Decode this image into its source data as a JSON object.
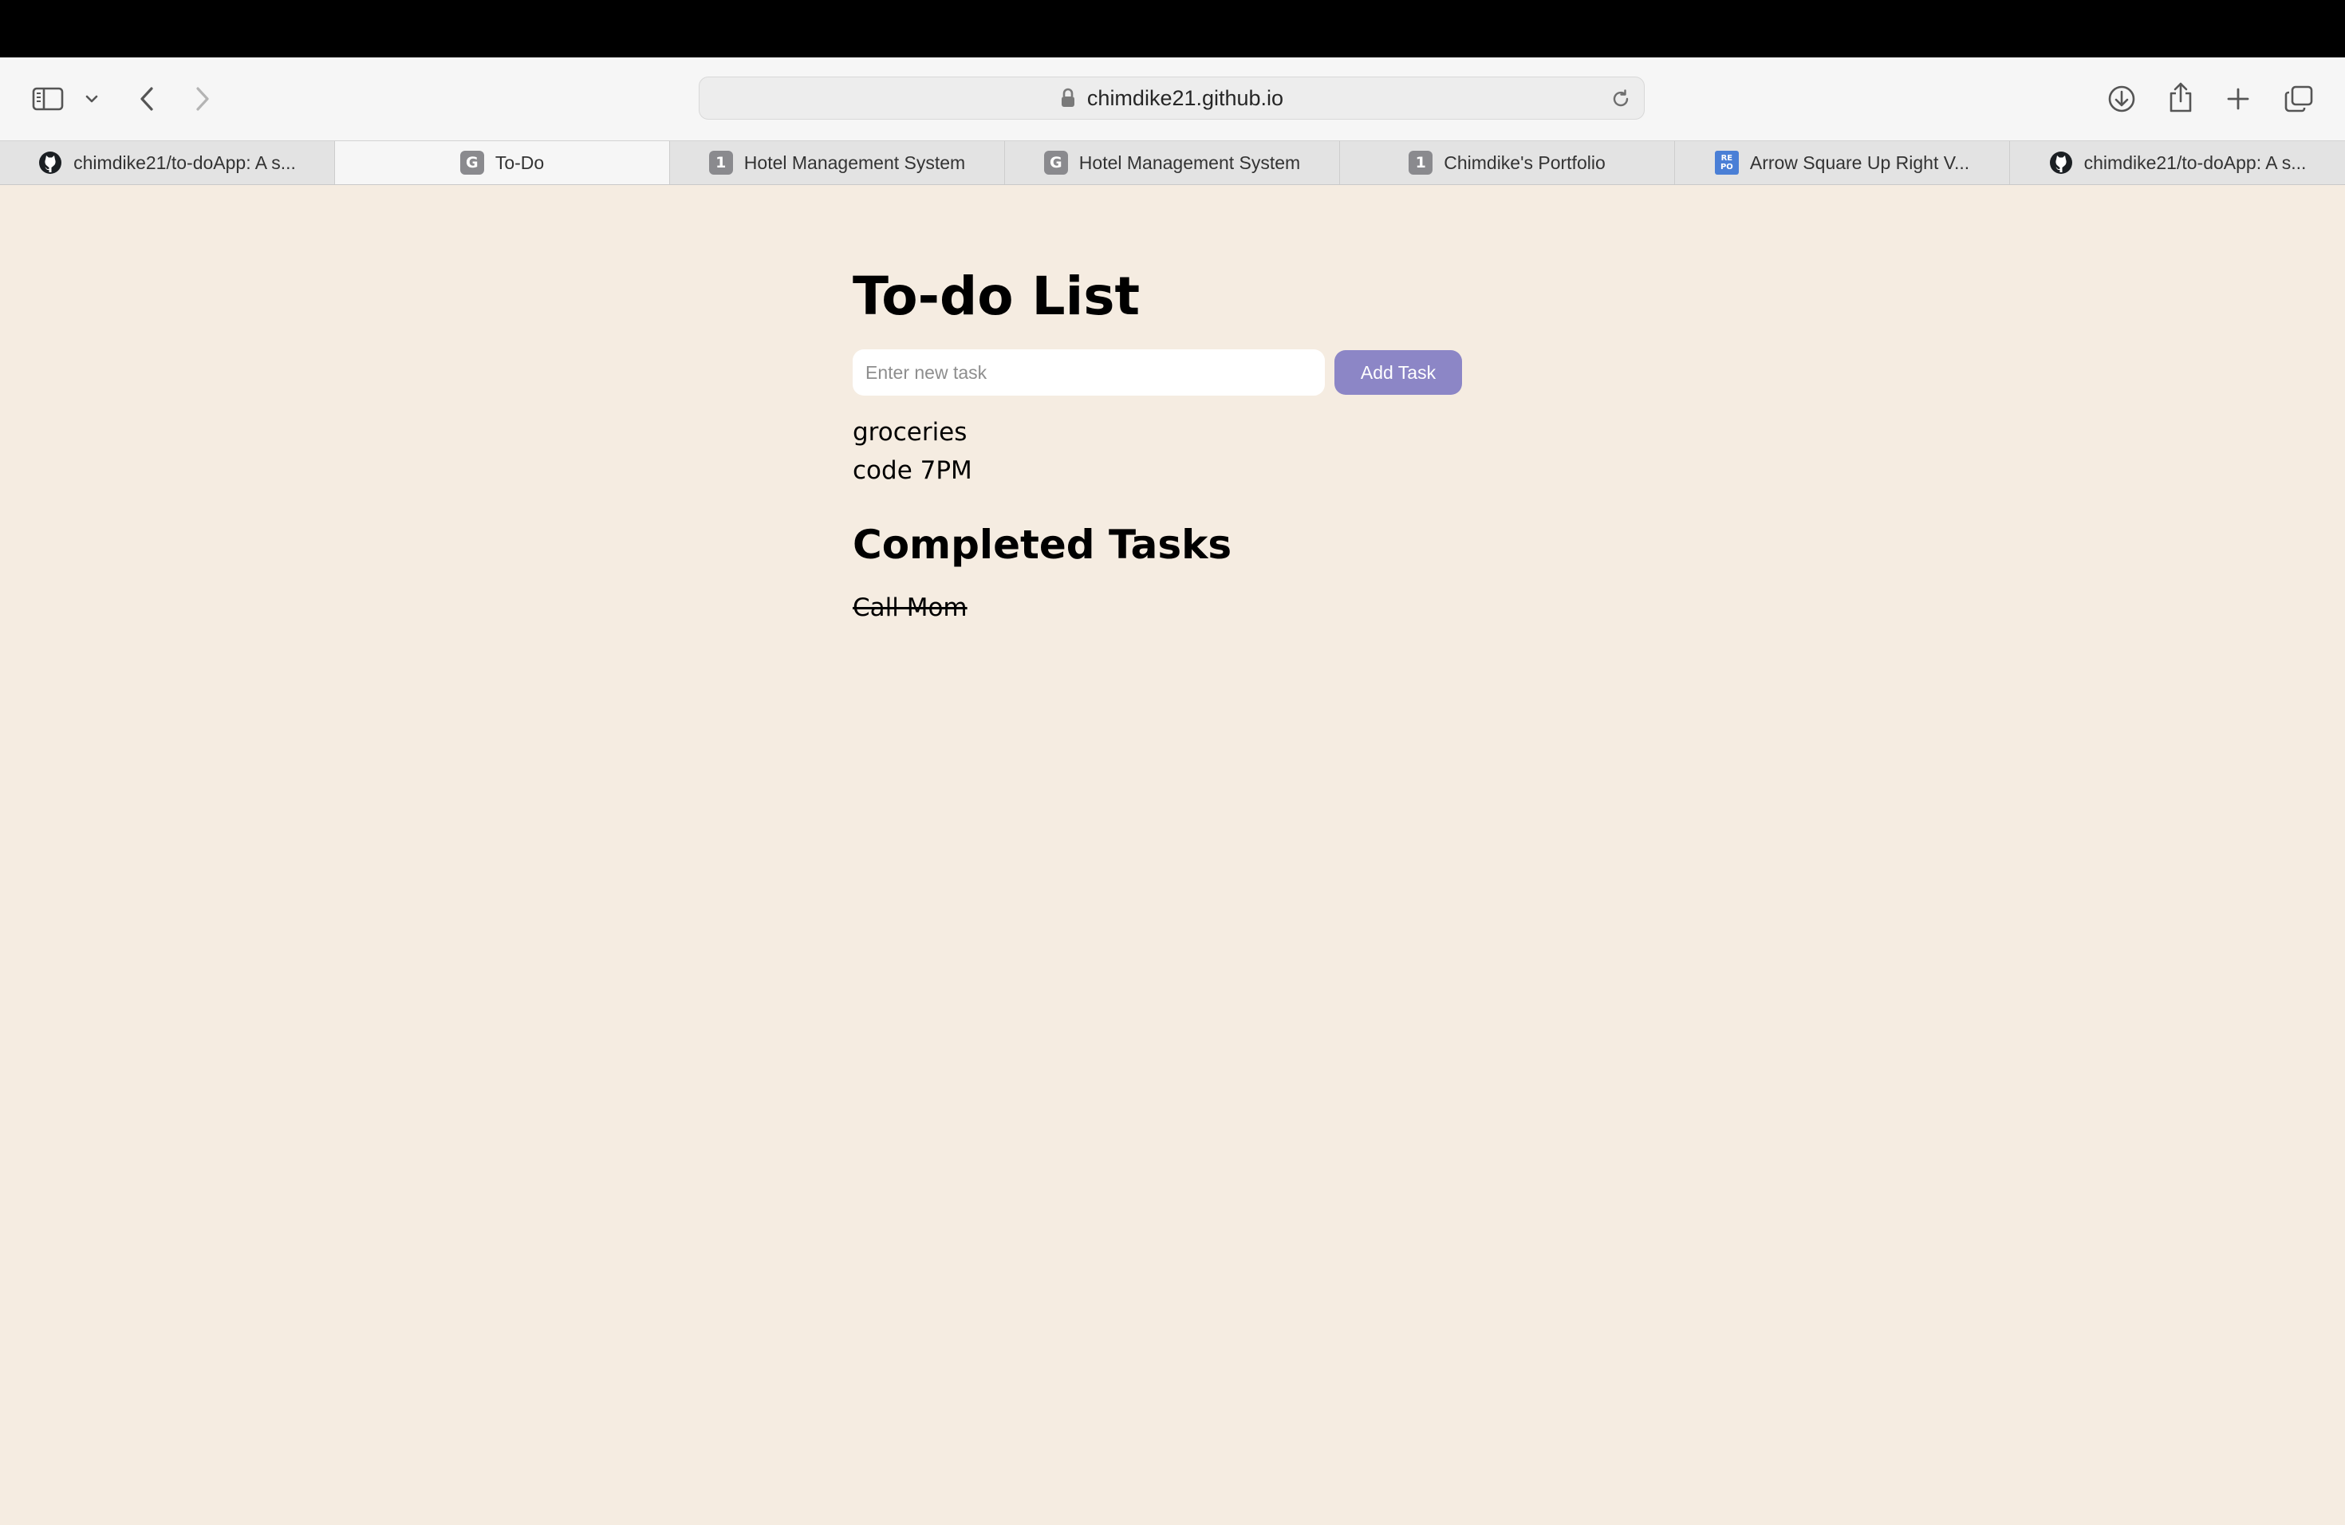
{
  "browser": {
    "url": "chimdike21.github.io",
    "tabs": [
      {
        "label": "chimdike21/to-doApp: A s...",
        "icon": "github-icon",
        "active": false
      },
      {
        "label": "To-Do",
        "icon": "G",
        "active": true
      },
      {
        "label": "Hotel Management System",
        "icon": "1",
        "active": false
      },
      {
        "label": "Hotel Management System",
        "icon": "G",
        "active": false
      },
      {
        "label": "Chimdike's Portfolio",
        "icon": "1",
        "active": false
      },
      {
        "label": "Arrow Square Up Right V...",
        "icon": "REPO",
        "active": false
      },
      {
        "label": "chimdike21/to-doApp: A s...",
        "icon": "github-icon",
        "active": false
      }
    ]
  },
  "page": {
    "title": "To-do List",
    "input_placeholder": "Enter new task",
    "input_value": "",
    "add_button_label": "Add Task",
    "tasks": [
      "groceries",
      "code 7PM"
    ],
    "completed_title": "Completed Tasks",
    "completed_tasks": [
      "Call Mom"
    ]
  },
  "colors": {
    "page_background": "#f5ece1",
    "add_button": "#8c86c6"
  }
}
